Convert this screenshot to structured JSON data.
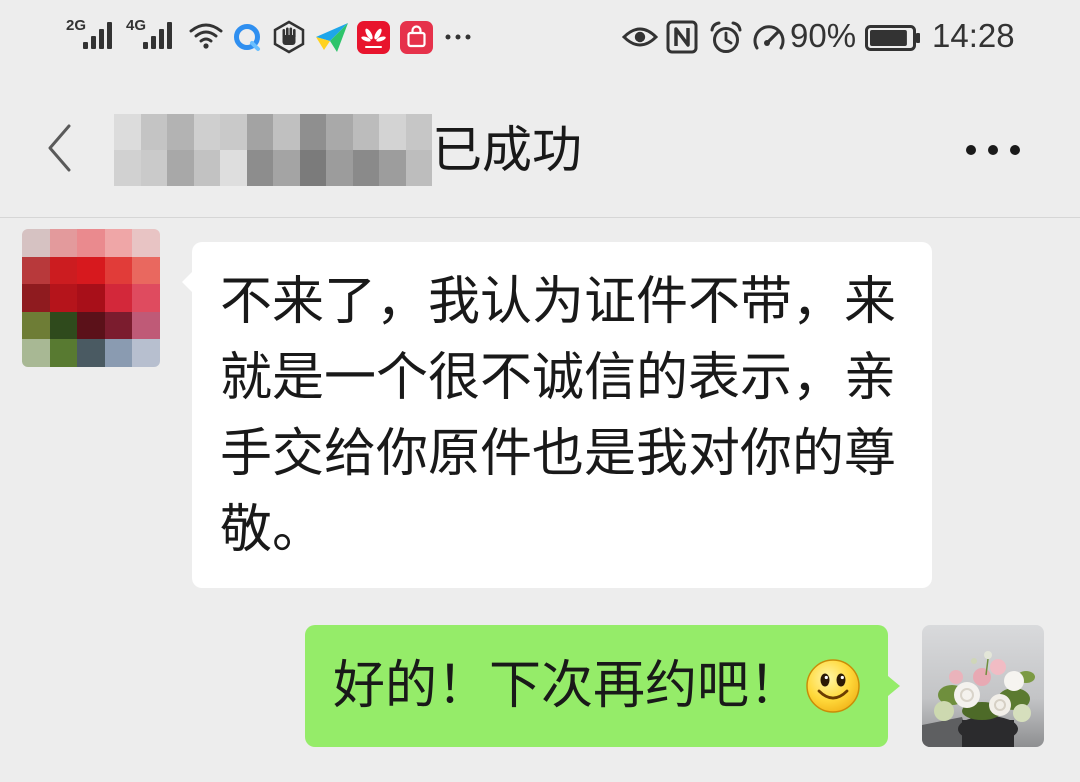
{
  "status_bar": {
    "sim1_network": "2G",
    "sim2_network": "4G",
    "icons_left": [
      "signal-bars-icon",
      "signal-bars-icon",
      "wifi-icon",
      "browser-app-icon",
      "hand-shield-app-icon",
      "paper-plane-app-icon",
      "huawei-app-icon",
      "vmall-app-icon",
      "more-notifications-icon"
    ],
    "icons_right": [
      "eye-comfort-icon",
      "nfc-icon",
      "alarm-icon",
      "data-speed-icon",
      "battery-icon"
    ],
    "battery_label": "90%",
    "battery_level": 0.9,
    "time": "14:28"
  },
  "header": {
    "title": "已成功",
    "back_icon": "chevron-left-icon",
    "more_icon": "more-dots-icon"
  },
  "chat": {
    "received": {
      "lines": [
        "不来了，我认为证件不带，来",
        "就是一个很不诚信的表示，亲",
        "手交给你原件也是我对你的尊",
        "敬。"
      ]
    },
    "sent": {
      "text": "好的！下次再约吧！",
      "emoji": "smile-emoji-icon"
    }
  },
  "colors": {
    "background": "#ededed",
    "received_bubble": "#ffffff",
    "sent_bubble": "#95ec69",
    "text": "#191919"
  }
}
